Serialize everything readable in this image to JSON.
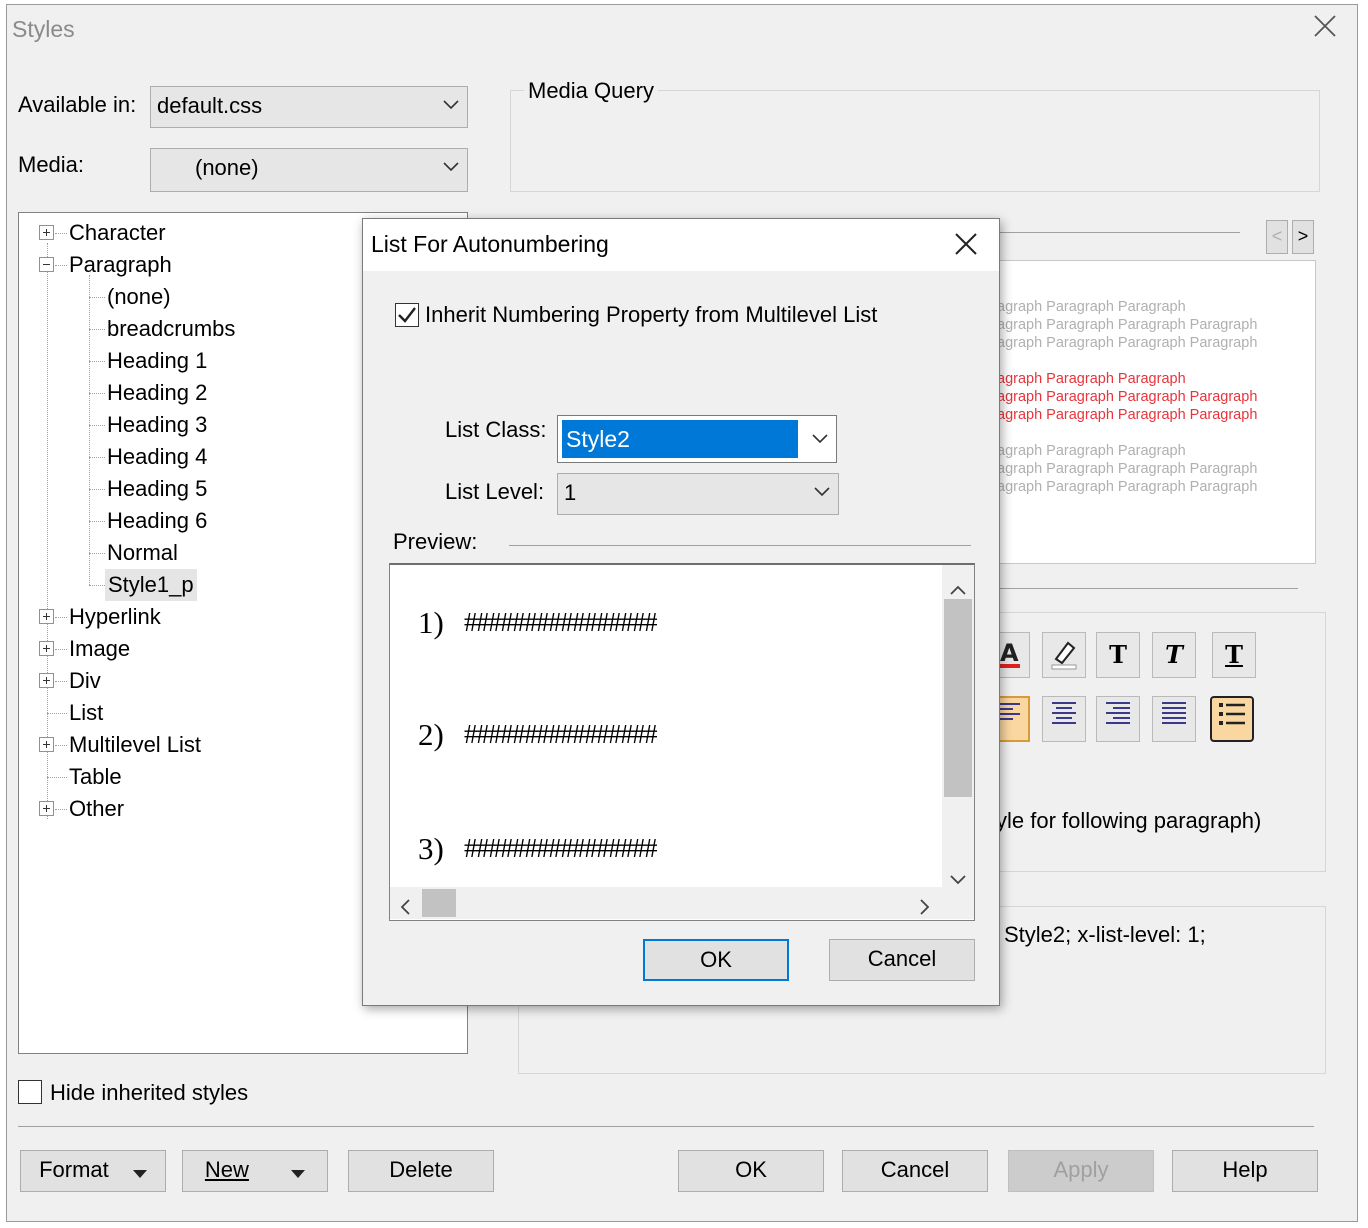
{
  "window": {
    "title": "Styles"
  },
  "available_in": {
    "label": "Available in:",
    "value": "default.css"
  },
  "media": {
    "label": "Media:",
    "value": "(none)"
  },
  "media_query": {
    "title": "Media Query"
  },
  "tree": {
    "character": "Character",
    "paragraph": "Paragraph",
    "paragraph_children": [
      "(none)",
      "breadcrumbs",
      "Heading 1",
      "Heading 2",
      "Heading 3",
      "Heading 4",
      "Heading 5",
      "Heading 6",
      "Normal",
      "Style1_p"
    ],
    "hyperlink": "Hyperlink",
    "image": "Image",
    "div": "Div",
    "list": "List",
    "multilevel_list": "Multilevel List",
    "table": "Table",
    "other": "Other"
  },
  "hide_inherited": {
    "label": "Hide inherited styles",
    "checked": false
  },
  "bottom_buttons": {
    "format": "Format",
    "new": "New",
    "delete": "Delete",
    "ok": "OK",
    "cancel": "Cancel",
    "apply": "Apply",
    "help": "Help"
  },
  "background_preview": {
    "gray_top": [
      "agraph Paragraph Paragraph",
      "agraph Paragraph Paragraph Paragraph",
      "agraph Paragraph Paragraph Paragraph"
    ],
    "red": [
      "agraph Paragraph Paragraph",
      "agraph Paragraph Paragraph Paragraph",
      "agraph Paragraph Paragraph Paragraph"
    ],
    "gray_bottom": [
      "agraph Paragraph Paragraph",
      "agraph Paragraph Paragraph Paragraph",
      "agraph Paragraph Paragraph Paragraph"
    ],
    "red_color": "#e8343c",
    "gray_color": "#b0b0b0"
  },
  "following_text": "yle for following paragraph)",
  "css_text": "Style2;  x-list-level: 1;",
  "dialog": {
    "title": "List For Autonumbering",
    "inherit": {
      "label": "Inherit Numbering Property from Multilevel List",
      "checked": true
    },
    "list_class": {
      "label": "List Class:",
      "value": "Style2"
    },
    "list_level": {
      "label": "List Level:",
      "value": "1"
    },
    "preview_label": "Preview:",
    "preview_items": [
      {
        "num": "1)",
        "text": "################"
      },
      {
        "num": "2)",
        "text": "################"
      },
      {
        "num": "3)",
        "text": "################"
      }
    ],
    "ok": "OK",
    "cancel": "Cancel",
    "selection_color": "#0078d7",
    "accent_color": "#0078d7"
  }
}
